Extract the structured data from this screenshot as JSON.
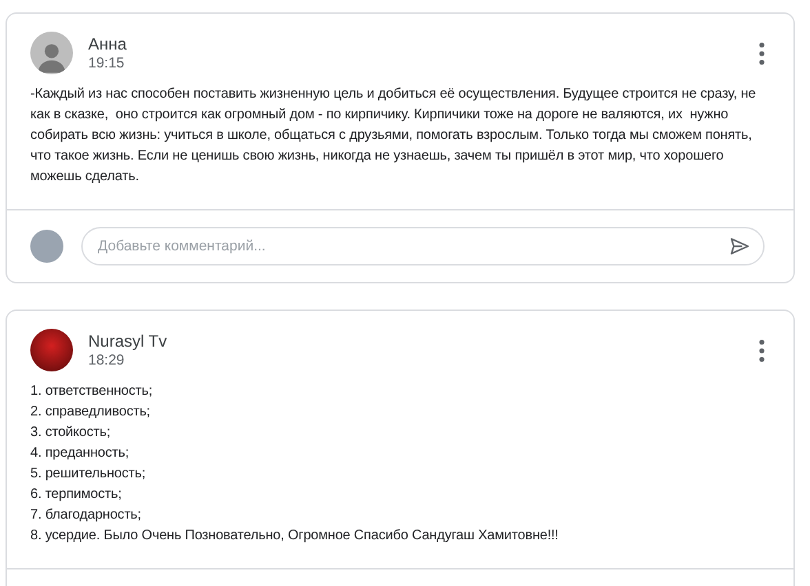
{
  "posts": [
    {
      "author": "Анна",
      "time": "19:15",
      "avatar": {
        "kind": "silhouette"
      },
      "body": [
        "-Каждый из нас способен поставить жизненную цель и добиться её осуществления. Будущее строится не сразу, не как в сказке,  оно строится как огромный дом - по кирпичику. Кирпичики тоже на дороге не валяются, их  нужно собирать всю жизнь: учиться в школе, общаться с друзьями, помогать взрослым. Только тогда мы сможем понять, что такое жизнь. Если не ценишь свою жизнь, никогда не узнаешь, зачем ты пришёл в этот мир, что хорошего можешь сделать."
      ],
      "comment_field": {
        "placeholder": "Добавьте комментарий..."
      }
    },
    {
      "author": "Nurasyl Tv",
      "time": "18:29",
      "avatar": {
        "kind": "photo"
      },
      "body": [
        "1. ответственность;",
        "2. справедливость;",
        "3. стойкость;",
        "4. преданность;",
        "5. решительность;",
        "6. терпимость;",
        "7. благодарность;",
        "8. усердие. Было Очень Позновательно, Огромное Спасибо Сандугаш Хамитовне!!!"
      ]
    }
  ]
}
